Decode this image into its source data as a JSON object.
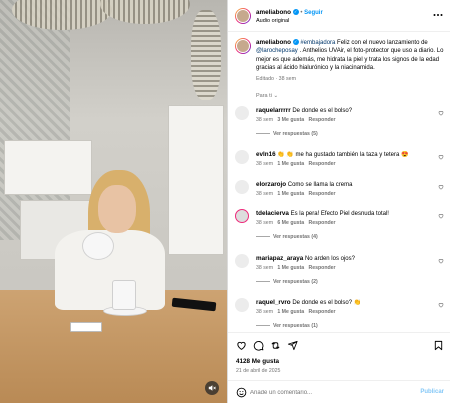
{
  "header": {
    "username": "ameliabono",
    "separator": "•",
    "follow_label": "Seguir",
    "audio": "Audio original",
    "more_icon": "more-horizontal-icon"
  },
  "caption": {
    "username": "ameliabono",
    "tag": "#embajadora",
    "text_1": " Feliz con el nuevo lanzamiento de ",
    "mention": "@larocheposay",
    "text_2": " . Anthelios UVAir, el foto-protector que uso a diario. Lo mejor es que además, me hidrata la piel y trata los signos de la edad gracias al ácido hialurónico y la niacinamida.",
    "meta": "Editado · 38 sem"
  },
  "for_you_label": "Para ti",
  "comments": [
    {
      "user": "raquelarrrrr",
      "text": "De donde es el bolso?",
      "time": "38 sem",
      "likes": "3 Me gusta",
      "reply": "Responder",
      "replies_label": "Ver respuestas (5)"
    },
    {
      "user": "evln16",
      "text": "👏 👏 me ha gustado también la taza y tetera 😍",
      "time": "38 sem",
      "likes": "1 Me gusta",
      "reply": "Responder",
      "replies_label": ""
    },
    {
      "user": "elorzarojo",
      "text": "Como se llama la crema",
      "time": "38 sem",
      "likes": "1 Me gusta",
      "reply": "Responder",
      "replies_label": ""
    },
    {
      "user": "tdelacierva",
      "text": "Es la pera! Efecto Piel desnuda total!",
      "time": "38 sem",
      "likes": "6 Me gusta",
      "reply": "Responder",
      "replies_label": "Ver respuestas (4)"
    },
    {
      "user": "mariapaz_araya",
      "text": "No arden los ojos?",
      "time": "38 sem",
      "likes": "1 Me gusta",
      "reply": "Responder",
      "replies_label": "Ver respuestas (2)"
    },
    {
      "user": "raquel_rvro",
      "text": "De donde es el bolso? 👏",
      "time": "38 sem",
      "likes": "1 Me gusta",
      "reply": "Responder",
      "replies_label": "Ver respuestas (1)"
    }
  ],
  "stats": {
    "likes": "4128 Me gusta",
    "date": "21 de abril de 2025"
  },
  "comment_box": {
    "placeholder": "Añade un comentario...",
    "post_label": "Publicar"
  },
  "colors": {
    "accent": "#0095f6",
    "text": "#000000",
    "muted": "#737373",
    "post_disabled": "#85c8f7"
  }
}
